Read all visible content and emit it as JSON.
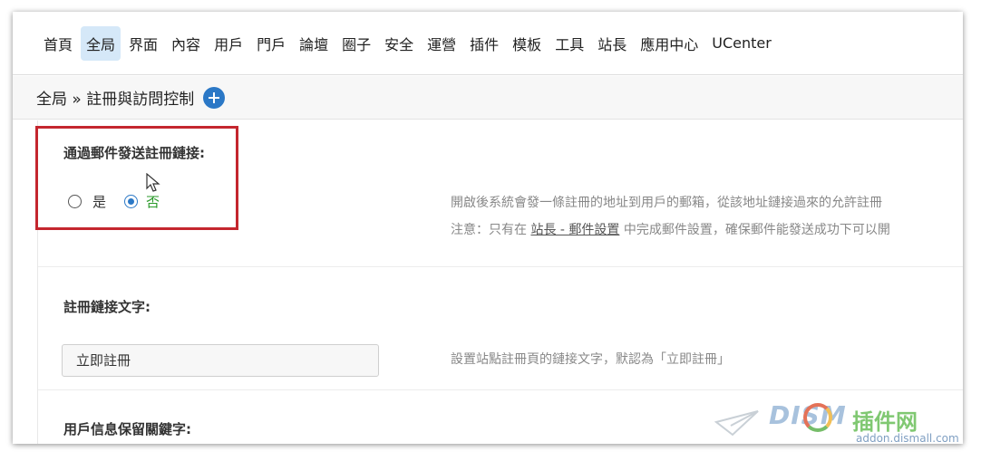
{
  "nav": {
    "items": [
      "首頁",
      "全局",
      "界面",
      "內容",
      "用戶",
      "門戶",
      "論壇",
      "圈子",
      "安全",
      "運營",
      "插件",
      "模板",
      "工具",
      "站長",
      "應用中心",
      "UCenter"
    ],
    "active": "全局"
  },
  "breadcrumb": {
    "text": "全局 » 註冊與訪問控制"
  },
  "settings": {
    "email_register": {
      "label": "通過郵件發送註冊鏈接:",
      "option_yes": "是",
      "option_no": "否",
      "selected": "否",
      "desc_line1": "開啟後系統會發一條註冊的地址到用戶的郵箱，從該地址鏈接過來的允許註冊",
      "desc_line2_prefix": "注意：只有在",
      "desc_link": "站長 - 郵件設置",
      "desc_line2_suffix": "中完成郵件設置，確保郵件能發送成功下可以開"
    },
    "register_link_text": {
      "label": "註冊鏈接文字:",
      "value": "立即註冊",
      "desc": "設置站點註冊頁的鏈接文字，默認為「立即註冊」"
    },
    "reserved_keywords": {
      "label": "用戶信息保留關鍵字:"
    }
  },
  "watermark": {
    "brand": "DISM",
    "brand_suffix": "插件网",
    "url": "addon.dismall.com"
  },
  "colors": {
    "accent": "#2b78c6",
    "highlight": "#c4262e",
    "selected_text": "#2a9a2a"
  }
}
